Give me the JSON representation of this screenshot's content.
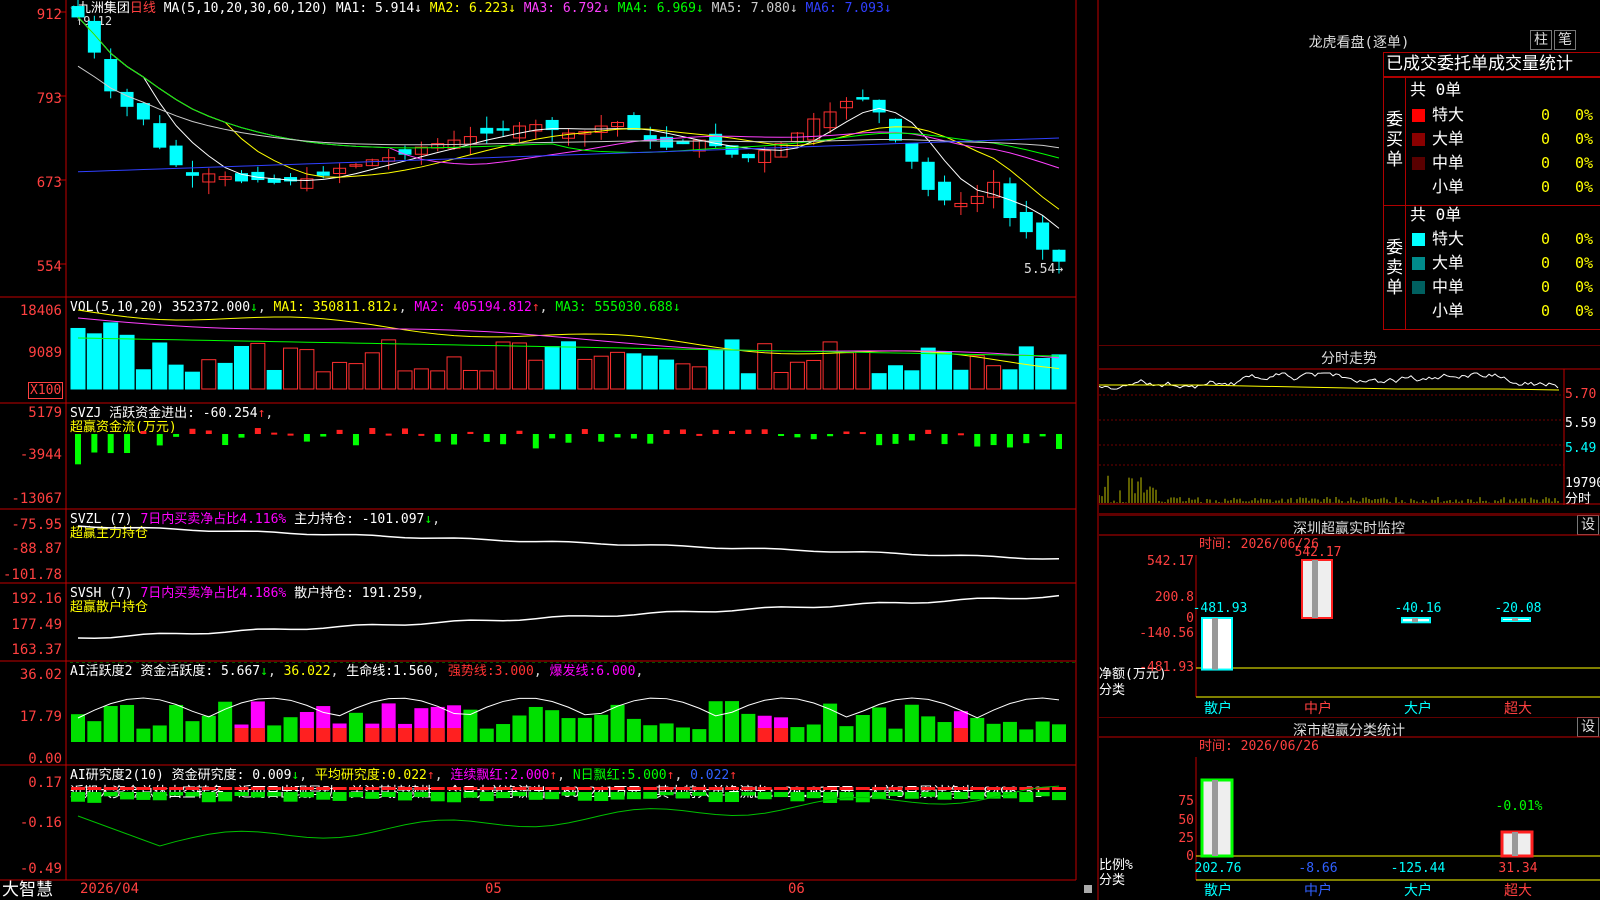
{
  "stock": {
    "name": "九洲集团",
    "period": "日线",
    "ma_label": "MA(5,10,20,30,60,120)",
    "ma": [
      {
        "label": "MA1:",
        "value": "5.914",
        "arrow": "↓",
        "color": "#ffffff"
      },
      {
        "label": "MA2:",
        "value": "6.223",
        "arrow": "↓",
        "color": "#ffff00"
      },
      {
        "label": "MA3:",
        "value": "6.792",
        "arrow": "↓",
        "color": "#ff40ff"
      },
      {
        "label": "MA4:",
        "value": "6.969",
        "arrow": "↓",
        "color": "#00ff00"
      },
      {
        "label": "MA5:",
        "value": "7.080",
        "arrow": "↓",
        "color": "#cccccc"
      },
      {
        "label": "MA6:",
        "value": "7.093",
        "arrow": "↓",
        "color": "#3040ff"
      }
    ],
    "high_mark": "9.12",
    "low_mark": "5.54",
    "price_axis": [
      "912",
      "793",
      "673",
      "554"
    ]
  },
  "vol": {
    "label": "VOL(5,10,20)",
    "value": "352372.000",
    "ma1": "350811.812",
    "ma2": "405194.812",
    "ma3": "555030.688",
    "axis": [
      "18406",
      "9089"
    ],
    "unit": "X100"
  },
  "svzj": {
    "label": "SVZJ",
    "desc": "活跃资金进出:",
    "value": "-60.254",
    "sub": "超赢资金流(万元)",
    "axis": [
      "5179",
      "-3944",
      "-13067"
    ]
  },
  "svzl": {
    "label": "SVZL (7)",
    "desc": "7日内买卖净占比4.116%",
    "desc2": "主力持仓:",
    "value": "-101.097",
    "sub": "超赢主力持仓",
    "axis": [
      "-75.95",
      "-88.87",
      "-101.78"
    ]
  },
  "svsh": {
    "label": "SVSH (7)",
    "desc": "7日内买卖净占比4.186%",
    "desc2": "散户持仓:",
    "value": "191.259",
    "sub": "超赢散户持仓",
    "axis": [
      "192.16",
      "177.49",
      "163.37"
    ]
  },
  "ai1": {
    "label": "AI活跃度2",
    "desc": "资金活跃度:",
    "v1": "5.667",
    "v2": "36.022",
    "life_label": "生命线:",
    "life": "1.560",
    "strong_label": "强势线:",
    "strong": "3.000",
    "burst_label": "爆发线:",
    "burst": "6.000",
    "axis": [
      "36.02",
      "17.79",
      "0.00"
    ]
  },
  "ai2": {
    "label": "AI研究度2(10)",
    "desc": "资金研究度:",
    "v1": "0.009",
    "avg_label": "平均研究度:",
    "avg": "0.022",
    "lh_label": "连续飘红:",
    "lh": "2.000",
    "nh_label": "N日飘红:",
    "nh": "5.000",
    "v5": "0.022",
    "comment": "近期大资金总体由空转多，近两日出现异动，关注其持续性，今日大单净流出:-60.241万元，其中特大单净流出:-20.08万元，大单5日累计净出-8496.51",
    "axis": [
      "0.17",
      "-0.16",
      "-0.49"
    ]
  },
  "bottom": {
    "brand": "大智慧",
    "dates": [
      "2026/04",
      "05",
      "06"
    ]
  },
  "lhb": {
    "title": "龙虎看盘(逐单)",
    "btn1": "柱",
    "btn2": "笔",
    "tabs": [
      "已成交",
      "委托单",
      "成交量",
      "统计"
    ],
    "buy_side": "委买单",
    "sell_side": "委卖单",
    "buy_total": "共 0单",
    "sell_total": "共 0单",
    "rows": [
      {
        "name": "特大",
        "n": "0",
        "p": "0%"
      },
      {
        "name": "大单",
        "n": "0",
        "p": "0%"
      },
      {
        "name": "中单",
        "n": "0",
        "p": "0%"
      },
      {
        "name": "小单",
        "n": "0",
        "p": "0%"
      }
    ],
    "buy_colors": [
      "#ff0000",
      "#8b0000",
      "#5a0000",
      ""
    ],
    "sell_colors": [
      "#00ffff",
      "#008b8b",
      "#006060",
      ""
    ]
  },
  "intraday": {
    "title": "分时走势",
    "axis": [
      "5.70",
      "5.59",
      "5.49"
    ],
    "vol_axis": "19790",
    "vol_unit": "分时"
  },
  "sz_monitor": {
    "title": "深圳超赢实时监控",
    "btn": "设",
    "time": "时间: 2026/06/26",
    "axis": [
      "542.17",
      "200.8",
      "0",
      "-140.56",
      "-481.93"
    ],
    "cats": [
      "散户",
      "中户",
      "大户",
      "超大"
    ],
    "values": [
      -481.93,
      542.17,
      -40.16,
      -20.08
    ],
    "labels": [
      "-481.93",
      "542.17",
      "-40.16",
      "-20.08"
    ],
    "ylabel": "净额(万元)",
    "xlabel": "分类"
  },
  "sz_class": {
    "title": "深市超赢分类统计",
    "btn": "设",
    "time": "时间: 2026/06/26",
    "axis": [
      "75",
      "50",
      "25",
      "0"
    ],
    "cats": [
      "散户",
      "中户",
      "大户",
      "超大"
    ],
    "values": [
      202.76,
      -8.66,
      -125.44,
      31.34
    ],
    "labels": [
      "202.76",
      "-8.66",
      "-125.44",
      "31.34"
    ],
    "pct_label": "-0.01%",
    "ylabel": "比例%",
    "xlabel": "分类"
  }
}
